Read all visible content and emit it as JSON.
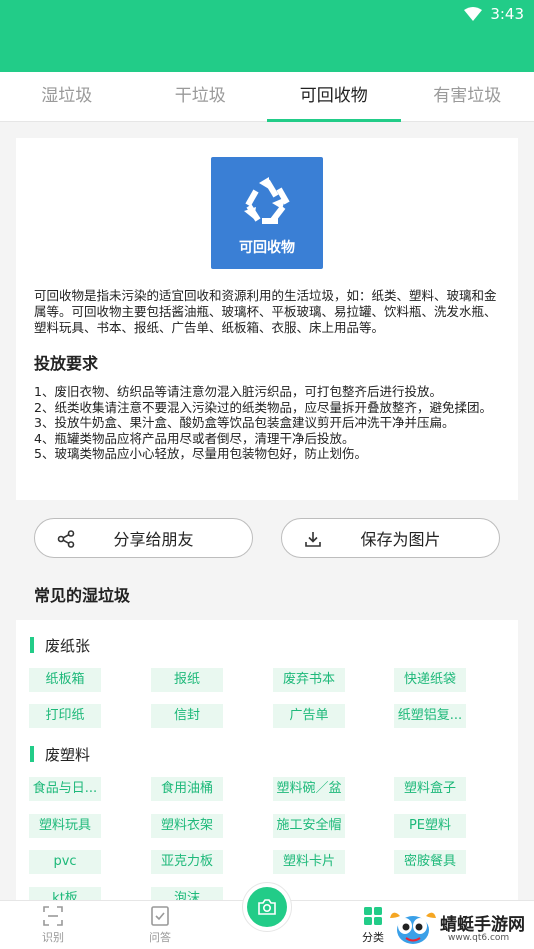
{
  "status": {
    "time": "3:43"
  },
  "tabs": [
    {
      "label": "湿垃圾"
    },
    {
      "label": "干垃圾"
    },
    {
      "label": "可回收物"
    },
    {
      "label": "有害垃圾"
    }
  ],
  "card": {
    "badge_label": "可回收物",
    "description": "可回收物是指未污染的适宜回收和资源利用的生活垃圾，如：纸类、塑料、玻璃和金属等。可回收物主要包括酱油瓶、玻璃杯、平板玻璃、易拉罐、饮料瓶、洗发水瓶、塑料玩具、书本、报纸、广告单、纸板箱、衣服、床上用品等。",
    "requirements_title": "投放要求",
    "requirements": [
      "1、废旧衣物、纺织品等请注意勿混入脏污织品，可打包整齐后进行投放。",
      "2、纸类收集请注意不要混入污染过的纸类物品，应尽量拆开叠放整齐，避免揉团。",
      "3、投放牛奶盒、果汁盒、酸奶盒等饮品包装盒建议剪开后冲洗干净并压扁。",
      "4、瓶罐类物品应将产品用尽或者倒尽，清理干净后投放。",
      "5、玻璃类物品应小心轻放，尽量用包装物包好，防止划伤。"
    ]
  },
  "actions": {
    "share_label": "分享给朋友",
    "save_label": "保存为图片"
  },
  "common_title": "常见的湿垃圾",
  "categories": [
    {
      "title": "废纸张",
      "items": [
        "纸板箱",
        "报纸",
        "废弃书本",
        "快递纸袋",
        "打印纸",
        "信封",
        "广告单",
        "纸塑铝复..."
      ]
    },
    {
      "title": "废塑料",
      "items": [
        "食品与日...",
        "食用油桶",
        "塑料碗／盆",
        "塑料盒子",
        "塑料玩具",
        "塑料衣架",
        "施工安全帽",
        "PE塑料",
        "pvc",
        "亚克力板",
        "塑料卡片",
        "密胺餐具",
        "kt板",
        "泡沫"
      ]
    }
  ],
  "bottom_nav": [
    {
      "label": "识别"
    },
    {
      "label": "问答"
    },
    {
      "label": "分类"
    }
  ],
  "watermark": {
    "title": "蜻蜓手游网",
    "url": "www.qt6.com"
  },
  "colors": {
    "accent": "#22cc88",
    "badge": "#3a7fd5",
    "chip_bg": "#e9f8f0",
    "chip_text": "#1eb97a"
  }
}
